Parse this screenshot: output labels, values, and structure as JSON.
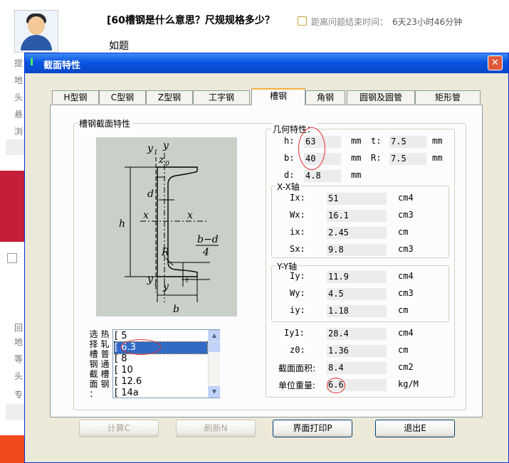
{
  "question": {
    "title": "[60槽钢是什么意思？尺规规格多少？",
    "body": "如题",
    "timer_label": "距离问题结束时间：",
    "timer_value": "6天23小时46分钟"
  },
  "background_fragments": [
    "提",
    "地",
    "头",
    "悬",
    "浏",
    "回",
    "地",
    "等",
    "头",
    "专"
  ],
  "dialog": {
    "title": "截面特性",
    "close_glyph": "✕",
    "tabs": [
      "H型钢",
      "C型钢",
      "Z型钢",
      "工字钢",
      "槽钢",
      "角钢",
      "圆钢及圆管",
      "矩形管"
    ],
    "active_tab": "槽钢",
    "section_group": "槽钢截面特性",
    "list_label": [
      "选",
      "择",
      "槽",
      "钢",
      "截",
      "面",
      "："
    ],
    "list_label2": [
      "热",
      "轧",
      "普",
      "通",
      "槽",
      "钢"
    ],
    "list_items": [
      "[ 5",
      "[ 6.3",
      "[ 8",
      "[ 10",
      "[ 12.6",
      "[ 14a"
    ],
    "selected_item": "[ 6.3",
    "geometry": {
      "label": "几何特性：",
      "h": {
        "label": "h:",
        "value": "63",
        "unit": "mm"
      },
      "t": {
        "label": "t:",
        "value": "7.5",
        "unit": "mm"
      },
      "b": {
        "label": "b:",
        "value": "40",
        "unit": "mm"
      },
      "R": {
        "label": "R:",
        "value": "7.5",
        "unit": "mm"
      },
      "d": {
        "label": "d:",
        "value": "4.8",
        "unit": "mm"
      }
    },
    "xx": {
      "label": "X-X轴",
      "rows": [
        {
          "label": "Ix:",
          "value": "51",
          "unit": "cm4"
        },
        {
          "label": "Wx:",
          "value": "16.1",
          "unit": "cm3"
        },
        {
          "label": "ix:",
          "value": "2.45",
          "unit": "cm"
        },
        {
          "label": "Sx:",
          "value": "9.8",
          "unit": "cm3"
        }
      ]
    },
    "yy": {
      "label": "Y-Y轴",
      "rows": [
        {
          "label": "Iy:",
          "value": "11.9",
          "unit": "cm4"
        },
        {
          "label": "Wy:",
          "value": "4.5",
          "unit": "cm3"
        },
        {
          "label": "iy:",
          "value": "1.18",
          "unit": "cm"
        }
      ]
    },
    "extra": [
      {
        "label": "Iy1:",
        "value": "28.4",
        "unit": "cm4"
      },
      {
        "label": "z0:",
        "value": "1.36",
        "unit": "cm"
      },
      {
        "label": "截面面积:",
        "value": "8.4",
        "unit": "cm2"
      },
      {
        "label": "单位重量:",
        "value": "6.6",
        "unit": "kg/M"
      }
    ],
    "buttons": [
      {
        "label": "计算C",
        "enabled": false
      },
      {
        "label": "刷新N",
        "enabled": false
      },
      {
        "label": "界面打印P",
        "enabled": true
      },
      {
        "label": "退出E",
        "enabled": true
      }
    ],
    "diagram_labels": {
      "y1_top": "y",
      "y1_top_sub": "1",
      "y_top": "y",
      "z0": "z",
      "z0_sub": "0",
      "d": "d",
      "x_left": "x",
      "x_right": "x",
      "h": "h",
      "R": "R",
      "frac_num": "b−d",
      "frac_den": "4",
      "t": "t",
      "y1_bot": "y",
      "y1_bot_sub": "1",
      "y_bot": "y",
      "b": "b"
    }
  },
  "colors": {
    "titlebar": "#0a53e0",
    "dialog_bg": "#ece9d8",
    "selected": "#316ac5",
    "annotation": "#e03030"
  }
}
